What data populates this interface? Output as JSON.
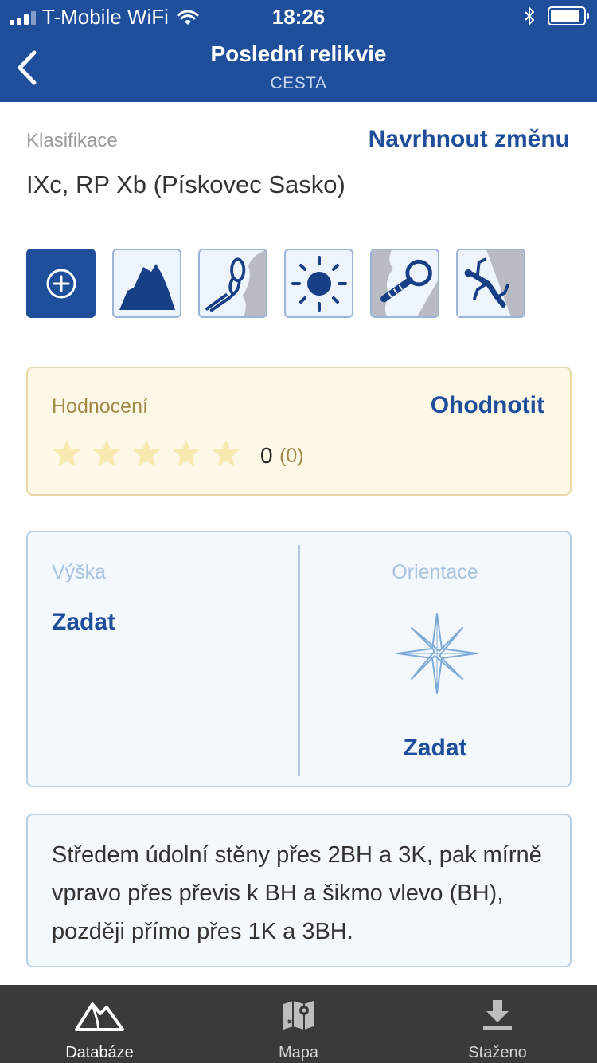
{
  "status_bar": {
    "carrier": "T-Mobile WiFi",
    "time": "18:26",
    "battery_level": 0.9
  },
  "header": {
    "title": "Poslední relikvie",
    "subtitle": "CESTA",
    "back_icon": "chevron-left-icon"
  },
  "classification": {
    "label": "Klasifikace",
    "suggest_label": "Navrhnout změnu",
    "grade": "IXc, RP Xb (Pískovec Sasko)"
  },
  "feature_icons": [
    "add-icon",
    "mountain-icon",
    "rope-icon",
    "sun-icon",
    "bolt-icon",
    "climber-icon"
  ],
  "rating": {
    "label": "Hodnocení",
    "action_label": "Ohodnotit",
    "value": "0",
    "count": "(0)",
    "stars_filled": 0,
    "stars_total": 5
  },
  "info": {
    "height_label": "Výška",
    "height_value": "Zadat",
    "orientation_label": "Orientace",
    "orientation_value": "Zadat"
  },
  "description": "Středem údolní stěny přes 2BH a 3K, pak mírně vpravo přes převis k BH a šikmo vlevo (BH), později přímo přes 1K a 3BH.",
  "tabs": [
    {
      "label": "Databáze",
      "icon": "mountains-icon",
      "active": true
    },
    {
      "label": "Mapa",
      "icon": "map-icon",
      "active": false
    },
    {
      "label": "Staženo",
      "icon": "download-icon",
      "active": false
    }
  ],
  "colors": {
    "primary": "#1f4e9b",
    "rating_bg": "#fdf8e6",
    "star_empty": "#f7e9b0",
    "tabbar_bg": "#3a3a3a"
  }
}
